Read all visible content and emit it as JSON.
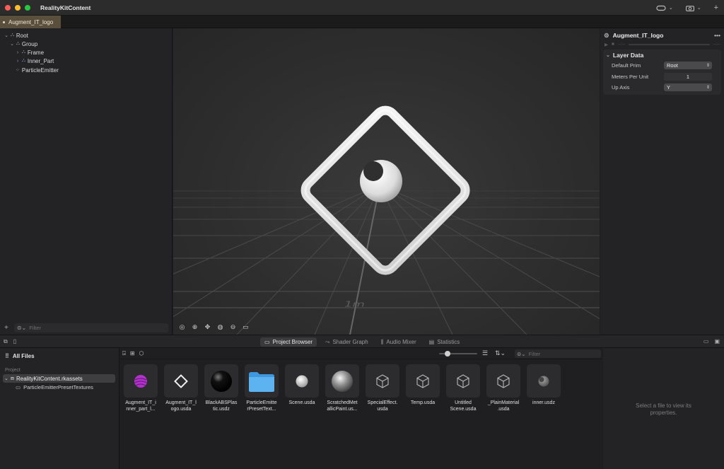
{
  "window": {
    "app_title": "RealityKitContent",
    "traffic_colors": [
      "#ff5f57",
      "#febc2e",
      "#28c840"
    ]
  },
  "tab": {
    "label": "Augment_IT_logo"
  },
  "hierarchy": {
    "items": [
      "Root",
      "Group",
      "Frame",
      "Inner_Part",
      "ParticleEmitter"
    ],
    "filter_placeholder": "Filter"
  },
  "viewport": {
    "grid_label": "1m"
  },
  "inspector": {
    "title": "Augment_IT_logo",
    "time_start": "--:--",
    "time_end": "--:--",
    "section": "Layer Data",
    "props": [
      {
        "label": "Default Prim",
        "value": "Root"
      },
      {
        "label": "Meters Per Unit",
        "value": "1"
      },
      {
        "label": "Up Axis",
        "value": "Y"
      }
    ]
  },
  "bottom_tabs": [
    "Project Browser",
    "Shader Graph",
    "Audio Mixer",
    "Statistics"
  ],
  "project": {
    "all_files": "All Files",
    "section_label": "Project",
    "root": "RealityKitContent.rkassets",
    "child": "ParticleEmitterPresetTextures"
  },
  "files": {
    "filter_placeholder": "Filter",
    "items": [
      {
        "name": "Augment_IT_inner_part_l...",
        "kind": "purple-sphere"
      },
      {
        "name": "Augment_IT_logo.usda",
        "kind": "diamond"
      },
      {
        "name": "BlackABSPlastic.usdz",
        "kind": "black-sphere"
      },
      {
        "name": "ParticleEmitterPresetText...",
        "kind": "folder"
      },
      {
        "name": "Scene.usda",
        "kind": "white-sphere"
      },
      {
        "name": "ScratchedMetallicPaint.us...",
        "kind": "metal-sphere"
      },
      {
        "name": "SpecialEffect.usda",
        "kind": "cube"
      },
      {
        "name": "Temp.usda",
        "kind": "cube"
      },
      {
        "name": "Untitled Scene.usda",
        "kind": "cube"
      },
      {
        "name": "_PlainMaterial.usda",
        "kind": "cube"
      },
      {
        "name": "inner.usdz",
        "kind": "gray-blob"
      }
    ],
    "label_lines": [
      [
        "Augment_IT_i",
        "nner_part_l..."
      ],
      [
        "Augment_IT_l",
        "ogo.usda"
      ],
      [
        "BlackABSPlas",
        "tic.usdz"
      ],
      [
        "ParticleEmitte",
        "rPresetText..."
      ],
      [
        "Scene.usda"
      ],
      [
        "ScratchedMet",
        "allicPaint.us..."
      ],
      [
        "SpecialEffect.",
        "usda"
      ],
      [
        "Temp.usda"
      ],
      [
        "Untitled",
        "Scene.usda"
      ],
      [
        "_PlainMaterial",
        ".usda"
      ],
      [
        "inner.usdz"
      ]
    ]
  },
  "properties_empty": "Select a file to view its properties."
}
